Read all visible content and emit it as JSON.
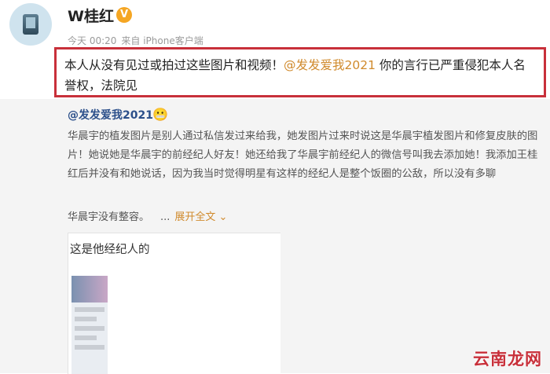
{
  "header": {
    "username": "W桂红",
    "verified_glyph": "V",
    "time": "今天 00:20",
    "source": "来自 iPhone客户端"
  },
  "post": {
    "text_before": "本人从没有见过或拍过这些图片和视频！",
    "mention": "@发发爱我2021",
    "text_after": " 你的言行已严重侵犯本人名誉权，法院见"
  },
  "repost": {
    "author": "@发发爱我2021",
    "emoji": "😬",
    "body": "华晨宇的植发图片是别人通过私信发过来给我，她发图片过来时说这是华晨宇植发图片和修复皮肤的图片！她说她是华晨宇的前经纪人好友！她还给我了华晨宇前经纪人的微信号叫我去添加她！我添加王桂红后并没有和她说话，因为我当时觉得明星有这样的经纪人是整个饭圈的公敌，所以没有多聊",
    "last_line": "华晨宇没有整容。",
    "ellipsis": "...",
    "expand_label": "展开全文 ⌄",
    "image_caption": "这是他经纪人的"
  },
  "watermark": "云南龙网",
  "colors": {
    "mention": "#d08a2c",
    "highlight_border": "#c8303a",
    "author": "#2b4f8a"
  }
}
